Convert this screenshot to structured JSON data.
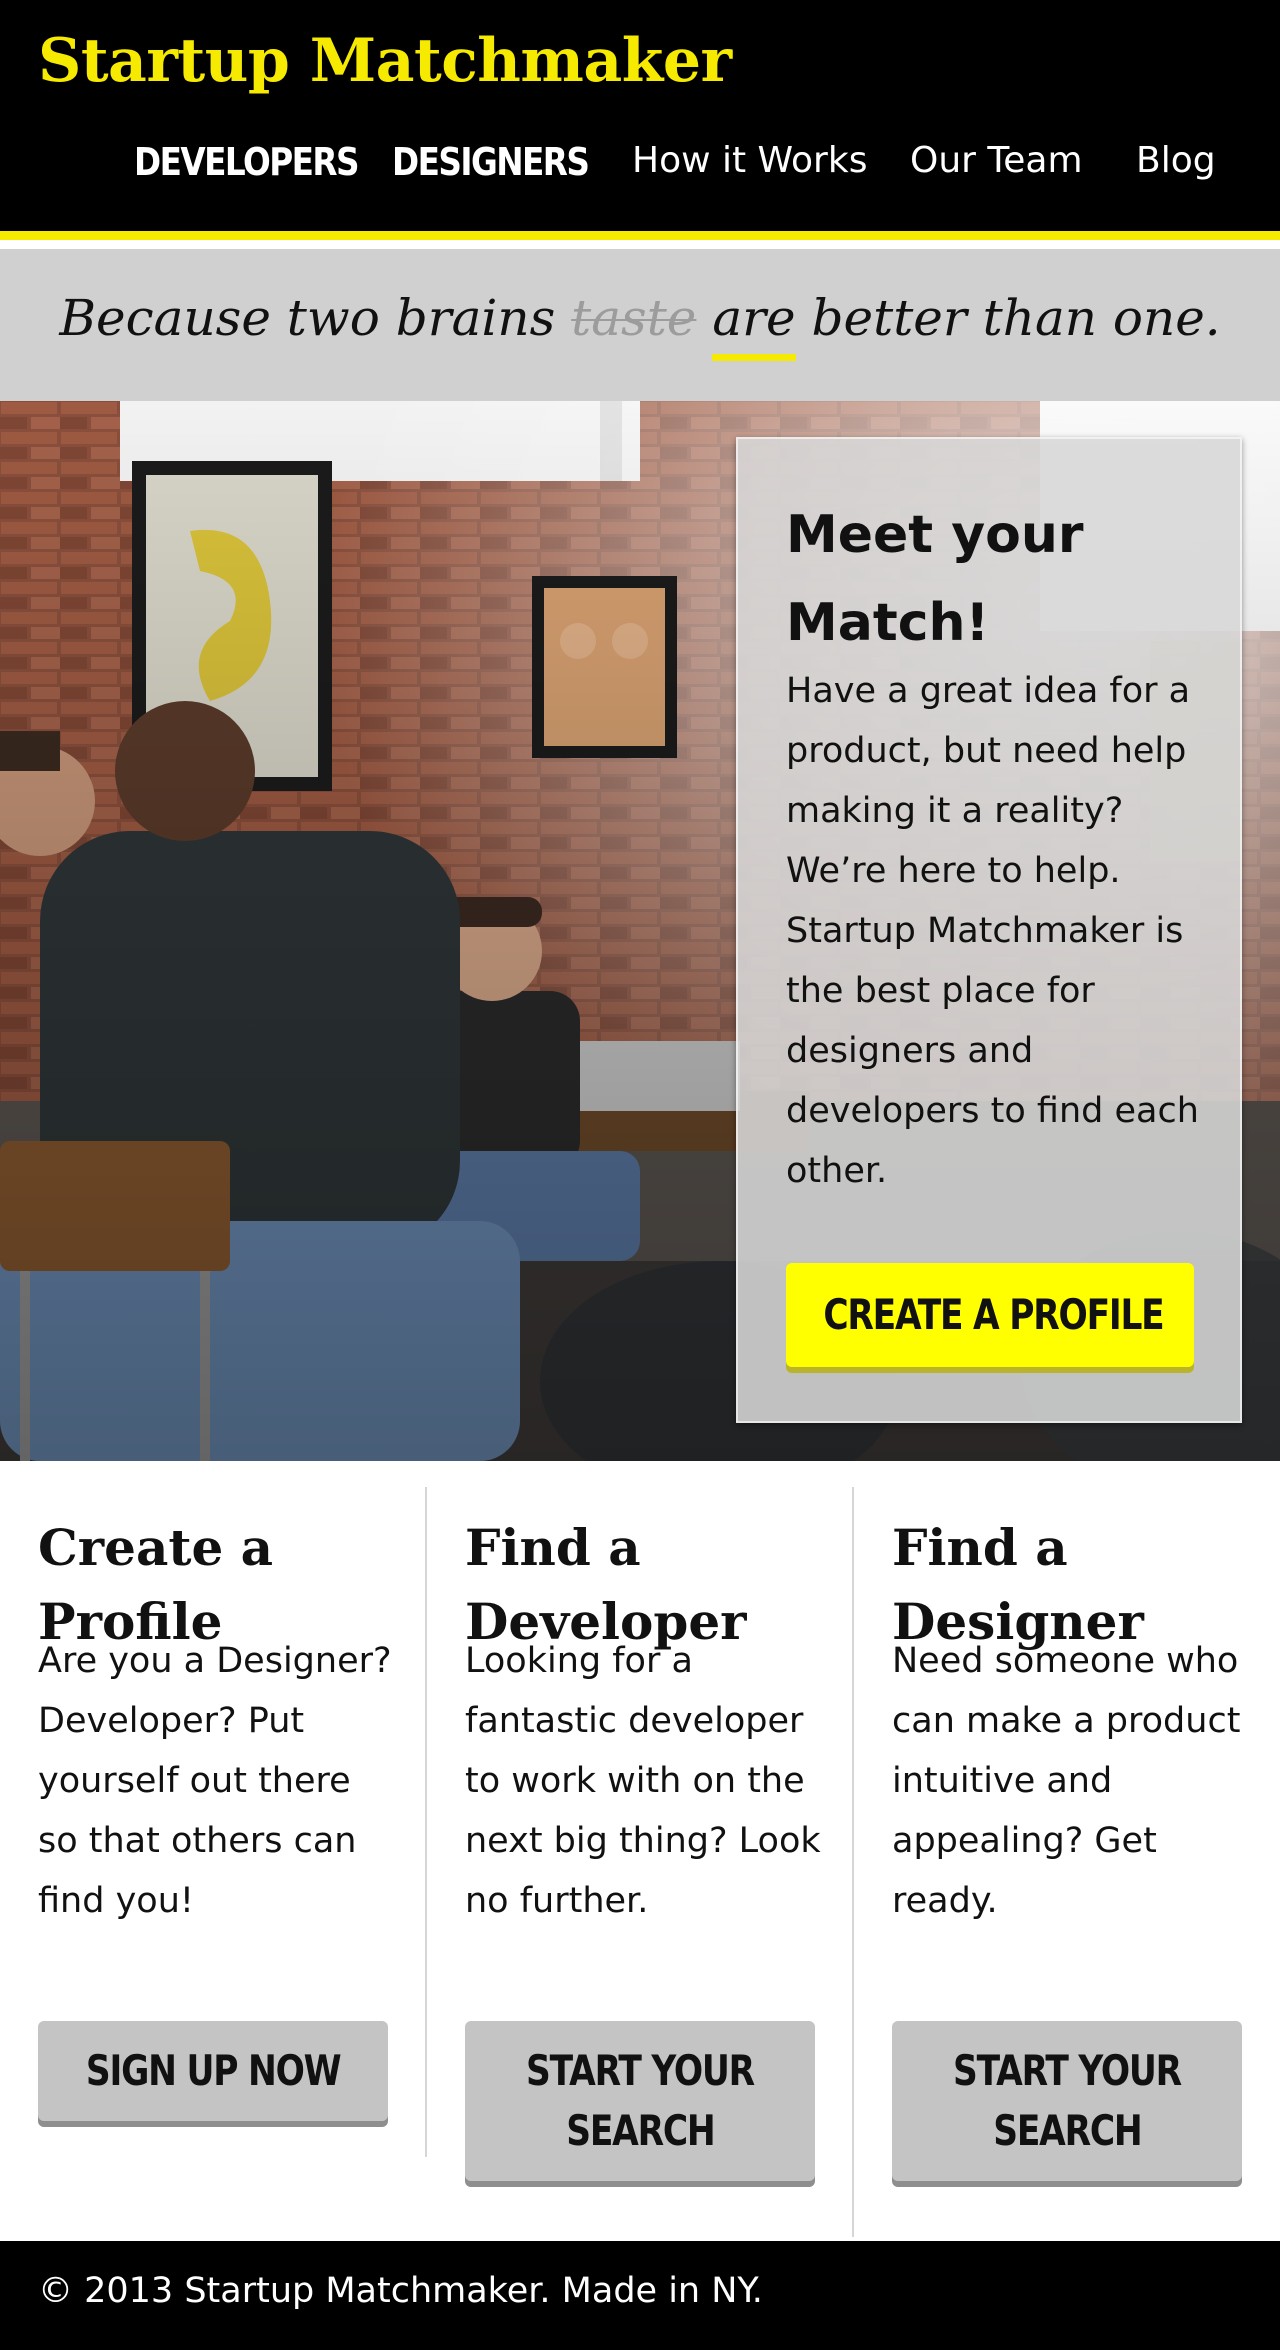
{
  "header": {
    "brand": "Startup Matchmaker",
    "nav": {
      "developers": "DEVELOPERS",
      "designers": "DESIGNERS",
      "how_it_works": "How it Works",
      "our_team": "Our Team",
      "blog": "Blog"
    }
  },
  "tagline": {
    "part1": "Because two brains ",
    "struck": "taste",
    "space": " ",
    "underlined": "are",
    "part2": " better than one."
  },
  "hero": {
    "card_title": "Meet your Match!",
    "card_body": "Have a great idea for a product, but need help making it a reality? We’re here to help. Startup Matchmaker is the best place for designers and developers to find each other.",
    "cta": "CREATE A PROFILE"
  },
  "features": [
    {
      "title": "Create a Profile",
      "body": "Are you a Designer? Developer? Put yourself out there so that others can find you!",
      "button": "SIGN UP NOW"
    },
    {
      "title": "Find a Developer",
      "body": "Looking for a fantastic developer to work with on the next big thing? Look no further.",
      "button_line1": "START YOUR",
      "button_line2": "SEARCH"
    },
    {
      "title": "Find a Designer",
      "body": "Need someone who can make a product intuitive and appealing? Get ready.",
      "button_line1": "START YOUR",
      "button_line2": "SEARCH"
    }
  ],
  "footer": {
    "copyright": "© 2013 Startup Matchmaker. Made in NY."
  },
  "colors": {
    "accent_yellow": "#f5ea00",
    "button_yellow": "#ffff00",
    "header_bg": "#000000",
    "tagline_bg": "#d0d0d0",
    "button_gray": "#c4c4c4"
  }
}
